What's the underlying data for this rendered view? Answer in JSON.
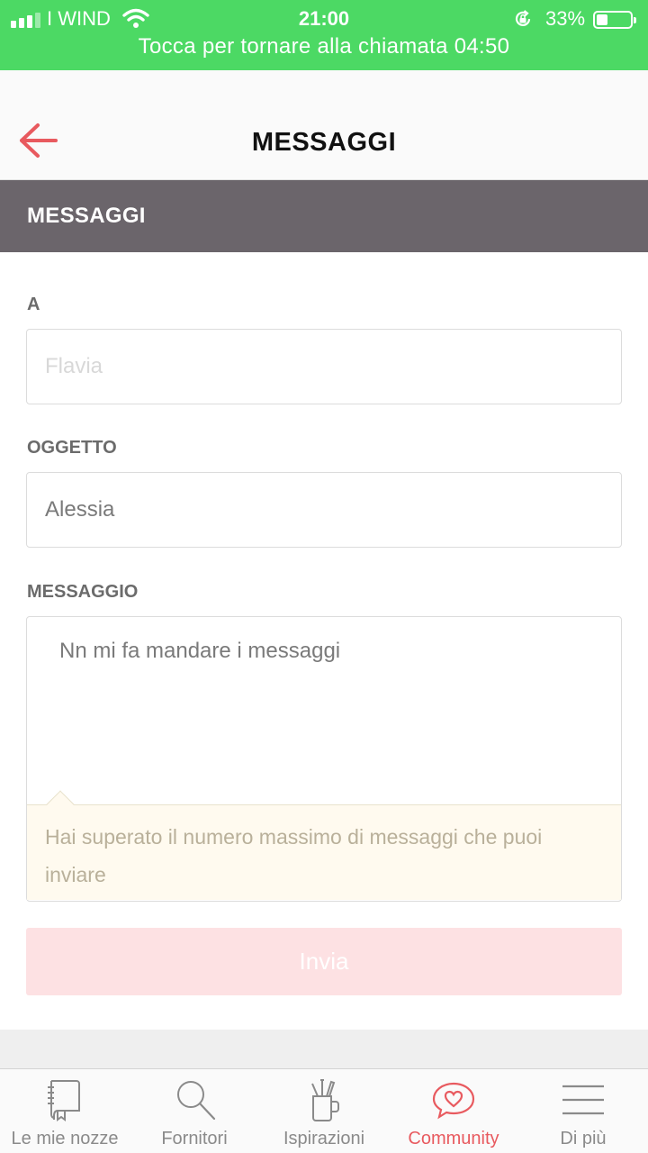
{
  "status_bar": {
    "carrier": "I WIND",
    "time": "21:00",
    "battery_percent": "33%",
    "call_banner": "Tocca per tornare alla chiamata 04:50",
    "color": "#4cd964"
  },
  "nav": {
    "title": "MESSAGGI",
    "back_icon": "arrow-left-icon",
    "accent": "#e85a5f"
  },
  "section": {
    "title": "MESSAGGI",
    "background": "#6b656b"
  },
  "form": {
    "to": {
      "label": "A",
      "value": "",
      "placeholder": "Flavia"
    },
    "subject": {
      "label": "OGGETTO",
      "value": "Alessia"
    },
    "message": {
      "label": "MESSAGGIO",
      "value": "Nn mi fa mandare i messaggi"
    },
    "error": "Hai superato il numero massimo di messaggi che puoi inviare",
    "submit_label": "Invia"
  },
  "tabs": [
    {
      "label": "Le mie nozze",
      "icon": "notebook-icon",
      "active": false
    },
    {
      "label": "Fornitori",
      "icon": "search-icon",
      "active": false
    },
    {
      "label": "Ispirazioni",
      "icon": "pencil-cup-icon",
      "active": false
    },
    {
      "label": "Community",
      "icon": "heart-chat-icon",
      "active": true
    },
    {
      "label": "Di più",
      "icon": "menu-icon",
      "active": false
    }
  ]
}
